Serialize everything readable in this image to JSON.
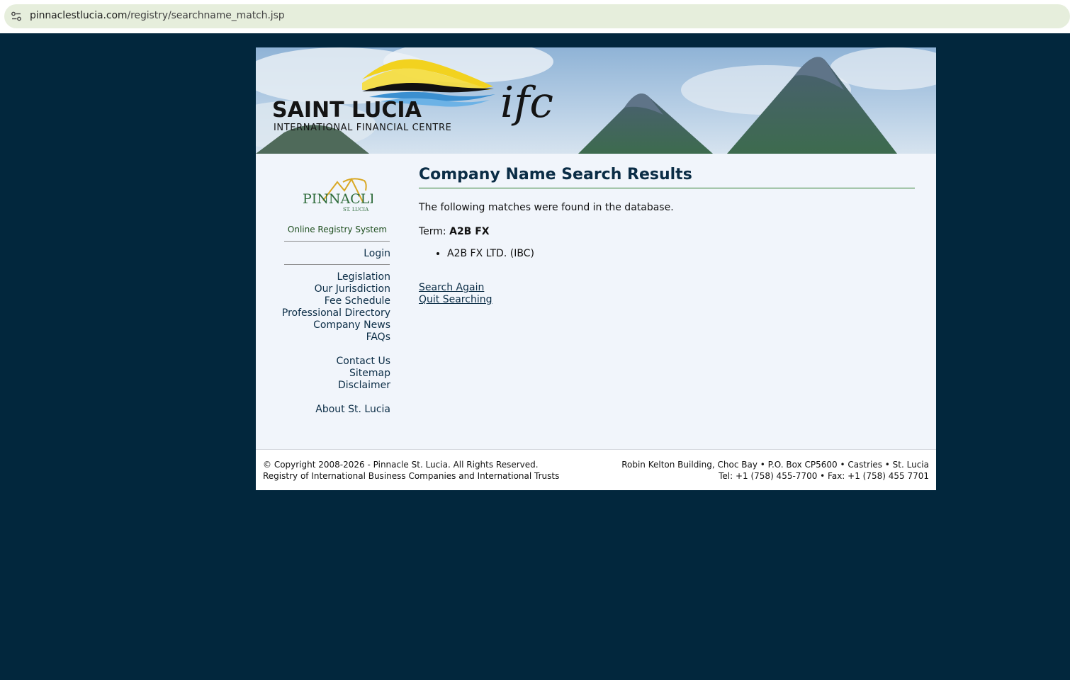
{
  "browser": {
    "url_domain": "pinnaclestlucia.com",
    "url_path": "/registry/searchname_match.jsp",
    "site_info_icon": "tune-icon"
  },
  "banner": {
    "logo_title": "SAINT LUCIA",
    "logo_subtitle": "INTERNATIONAL FINANCIAL CENTRE",
    "logo_mark": "ifc"
  },
  "sidebar": {
    "logo_name": "PINNACLE",
    "logo_sub": "ST. LUCIA",
    "system_label": "Online Registry System",
    "login": "Login",
    "links_group1": [
      "Legislation",
      "Our Jurisdiction",
      "Fee Schedule",
      "Professional Directory",
      "Company News",
      "FAQs"
    ],
    "links_group2": [
      "Contact Us",
      "Sitemap",
      "Disclaimer"
    ],
    "links_group3": [
      "About St. Lucia"
    ]
  },
  "main": {
    "title": "Company Name Search Results",
    "intro": "The following matches were found in the database.",
    "term_label": "Term:",
    "term_value": "A2B FX",
    "results": [
      "A2B FX LTD. (IBC)"
    ],
    "search_again": "Search Again",
    "quit_searching": "Quit Searching"
  },
  "footer": {
    "copyright": "© Copyright 2008-2026 - Pinnacle St. Lucia. All Rights Reserved.",
    "registry": "Registry of International Business Companies and International Trusts",
    "address": "Robin Kelton Building, Choc Bay • P.O. Box CP5600 • Castries • St. Lucia",
    "phone": "Tel: +1 (758) 455-7700 • Fax: +1 (758) 455 7701"
  },
  "colors": {
    "page_background": "#02273d",
    "content_background": "#f1f5fb",
    "title_color": "#0b2d46",
    "rule_green": "#2a7a2a"
  }
}
